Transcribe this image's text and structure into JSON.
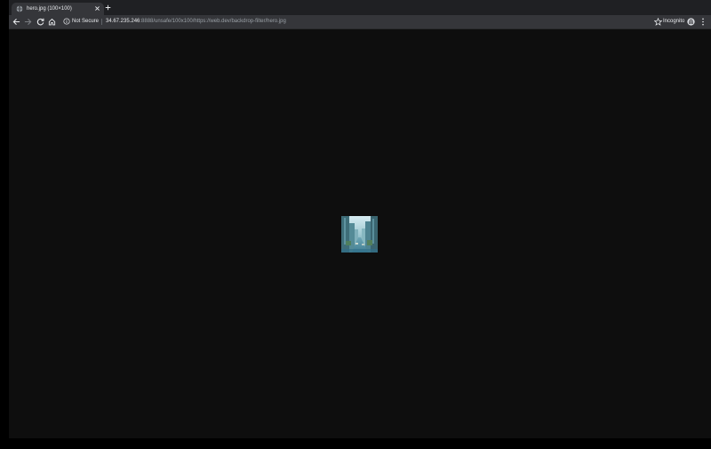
{
  "tab": {
    "title": "hero.jpg (100×100)",
    "favicon": "globe-icon",
    "close_icon": "close-icon",
    "new_tab_icon": "plus-icon"
  },
  "toolbar": {
    "back_icon": "arrow-left-icon",
    "forward_icon": "arrow-right-icon",
    "reload_icon": "reload-icon",
    "home_icon": "home-icon",
    "security_icon": "info-icon",
    "security_label": "Not Secure",
    "url_host": "34.67.235.246",
    "url_rest": ":8888/unsafe/100x100/https://web.dev/backdrop-filter/hero.jpg",
    "bookmark_icon": "star-icon",
    "incognito_label": "Incognito",
    "incognito_icon": "incognito-icon",
    "menu_icon": "kebab-menu-icon"
  },
  "page": {
    "image_description_icon": "city-street-photo",
    "background": "#0e0e0e"
  },
  "colors": {
    "tabstrip": "#1f2023",
    "toolbar": "#35363a",
    "text": "#e8eaed",
    "muted_text": "#9aa0a6"
  }
}
